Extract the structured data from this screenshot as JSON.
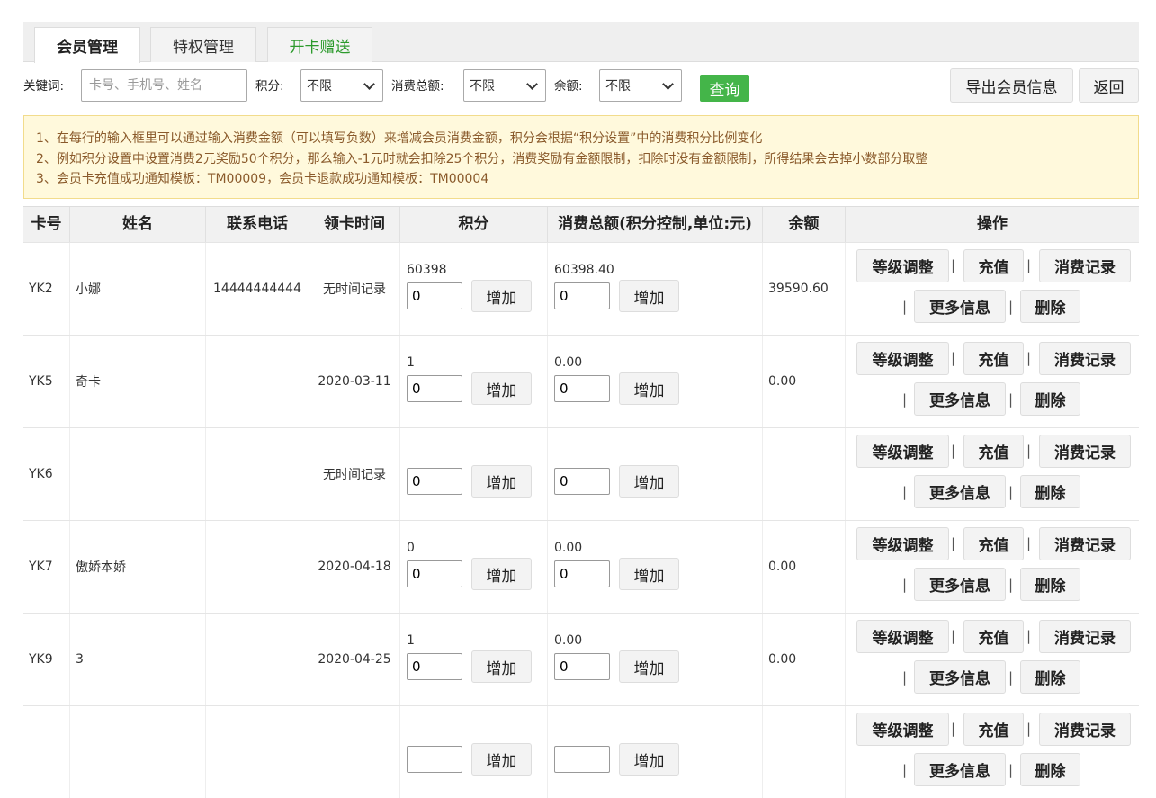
{
  "tabs": [
    {
      "label": "会员管理"
    },
    {
      "label": "特权管理"
    },
    {
      "label": "开卡赠送"
    }
  ],
  "filters": {
    "keyword_label": "关键词:",
    "keyword_placeholder": "卡号、手机号、姓名",
    "points_label": "积分:",
    "points_value": "不限",
    "spend_label": "消费总额:",
    "spend_value": "不限",
    "balance_label": "余额:",
    "balance_value": "不限",
    "query_label": "查询",
    "export_label": "导出会员信息",
    "back_label": "返回"
  },
  "notice": {
    "lines": [
      "1、在每行的输入框里可以通过输入消费金额（可以填写负数）来增减会员消费金额，积分会根据“积分设置”中的消费积分比例变化",
      "2、例如积分设置中设置消费2元奖励50个积分，那么输入-1元时就会扣除25个积分，消费奖励有金额限制，扣除时没有金额限制，所得结果会去掉小数部分取整",
      "3、会员卡充值成功通知模板：TM00009，会员卡退款成功通知模板：TM00004"
    ]
  },
  "table": {
    "headers": [
      "卡号",
      "姓名",
      "联系电话",
      "领卡时间",
      "积分",
      "消费总额(积分控制,单位:元)",
      "余额",
      "操作"
    ],
    "add_label": "增加",
    "actions": {
      "level": "等级调整",
      "recharge": "充值",
      "records": "消费记录",
      "more": "更多信息",
      "delete": "删除",
      "sep": "|"
    },
    "rows": [
      {
        "card": "YK2",
        "name": "小娜",
        "phone": "14444444444",
        "time": "无时间记录",
        "points": "60398",
        "points_input": "0",
        "spend": "60398.40",
        "spend_input": "0",
        "balance": "39590.60"
      },
      {
        "card": "YK5",
        "name": "奇卡",
        "phone": "",
        "time": "2020-03-11",
        "points": "1",
        "points_input": "0",
        "spend": "0.00",
        "spend_input": "0",
        "balance": "0.00"
      },
      {
        "card": "YK6",
        "name": "",
        "phone": "",
        "time": "无时间记录",
        "points": "",
        "points_input": "0",
        "spend": "",
        "spend_input": "0",
        "balance": ""
      },
      {
        "card": "YK7",
        "name": "傲娇本娇",
        "phone": "",
        "time": "2020-04-18",
        "points": "0",
        "points_input": "0",
        "spend": "0.00",
        "spend_input": "0",
        "balance": "0.00"
      },
      {
        "card": "YK9",
        "name": "3",
        "phone": "",
        "time": "2020-04-25",
        "points": "1",
        "points_input": "0",
        "spend": "0.00",
        "spend_input": "0",
        "balance": "0.00"
      },
      {
        "card": "",
        "name": "",
        "phone": "",
        "time": "",
        "points": "",
        "points_input": "",
        "spend": "",
        "spend_input": "",
        "balance": ""
      }
    ]
  }
}
